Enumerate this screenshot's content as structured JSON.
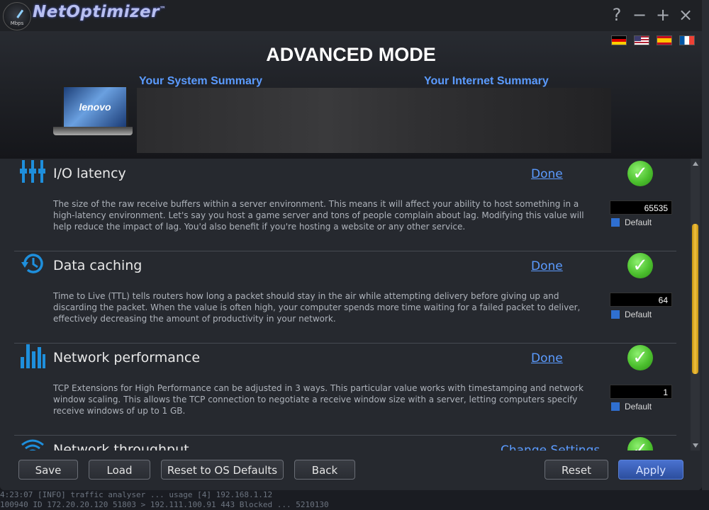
{
  "app": {
    "name": "NetOptimizer",
    "trademark": "™",
    "logo_text": "Mbps",
    "window_buttons": {
      "help": "?",
      "minimize": "−",
      "maximize": "+",
      "close": "×"
    }
  },
  "header": {
    "title": "ADVANCED MODE",
    "system_summary_label": "Your System Summary",
    "internet_summary_label": "Your Internet Summary",
    "laptop_brand": "lenovo",
    "languages": [
      "German",
      "English",
      "Spanish",
      "French"
    ]
  },
  "items": [
    {
      "title": "I/O latency",
      "action": "Done",
      "status": "checked",
      "description": "The size of the raw receive buffers within a server environment. This means it will affect your ability to host something in a high-latency environment. Let's say you host a game server and tons of people complain about lag. Modifying this value will help reduce the impact of lag. You'd also benefit if you're hosting a website or any other service.",
      "value": "65535",
      "default_label": "Default"
    },
    {
      "title": "Data caching",
      "action": "Done",
      "status": "checked",
      "description": "Time to Live (TTL) tells routers how long a packet should stay in the air while attempting delivery before giving up and discarding the packet. When the value is often high, your computer spends more time waiting for a failed packet to deliver, effectively decreasing the amount of productivity in your network.",
      "value": "64",
      "default_label": "Default"
    },
    {
      "title": "Network performance",
      "action": "Done",
      "status": "checked",
      "description": "TCP Extensions for High Performance can be adjusted in 3 ways. This particular value works with timestamping and network window scaling. This allows the TCP connection to negotiate a receive window size with a server, letting computers specify receive windows of up to 1 GB.",
      "value": "1",
      "default_label": "Default"
    },
    {
      "title": "Network throughput",
      "action": "Change Settings",
      "status": "checked"
    }
  ],
  "footer": {
    "save": "Save",
    "load": "Load",
    "reset_os": "Reset to OS Defaults",
    "back": "Back",
    "reset": "Reset",
    "apply": "Apply"
  },
  "background_terminal": [
    "4:23:07 [INFO] traffic analyser ... usage [4] 192.168.1.12",
    "100940 ID 172.20.20.120 51803 > 192.111.100.91 443 Blocked ... 5210130"
  ],
  "colors": {
    "accent": "#5b9bff",
    "check_green": "#4cc02e",
    "scroll_thumb": "#e0a820",
    "apply_button": "#3a62c0"
  }
}
